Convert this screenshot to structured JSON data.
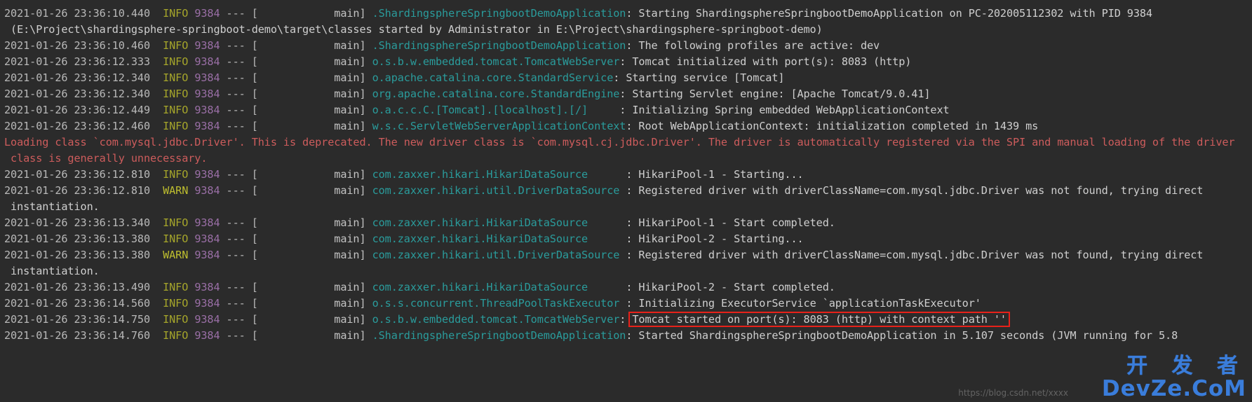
{
  "console": {
    "background_color": "#2b2b2b",
    "default_text_color": "#b7b7b7",
    "info_color": "#a5a52b",
    "warn_color": "#bdbd2f",
    "pid_color": "#9a6fa6",
    "logger_color": "#2a9c9c",
    "error_color": "#cd5c5c",
    "highlight_color": "#e8211a",
    "pid": "9384",
    "thread": "main"
  },
  "lines": [
    {
      "type": "log",
      "timestamp": "2021-01-26 23:36:10.440",
      "level": "INFO",
      "pid": "9384",
      "sep": "--- [",
      "thread": "            main]",
      "logger": ".ShardingsphereSpringbootDemoApplication",
      "colon": ": ",
      "message": "Starting ShardingsphereSpringbootDemoApplication on PC-202005112302 with PID 9384"
    },
    {
      "type": "continuation",
      "text": " (E:\\Project\\shardingsphere-springboot-demo\\target\\classes started by Administrator in E:\\Project\\shardingsphere-springboot-demo)"
    },
    {
      "type": "log",
      "timestamp": "2021-01-26 23:36:10.460",
      "level": "INFO",
      "pid": "9384",
      "sep": "--- [",
      "thread": "            main]",
      "logger": ".ShardingsphereSpringbootDemoApplication",
      "colon": ": ",
      "message": "The following profiles are active: dev"
    },
    {
      "type": "log",
      "timestamp": "2021-01-26 23:36:12.333",
      "level": "INFO",
      "pid": "9384",
      "sep": "--- [",
      "thread": "            main]",
      "logger": "o.s.b.w.embedded.tomcat.TomcatWebServer",
      "colon": ": ",
      "message": "Tomcat initialized with port(s): 8083 (http)"
    },
    {
      "type": "log",
      "timestamp": "2021-01-26 23:36:12.340",
      "level": "INFO",
      "pid": "9384",
      "sep": "--- [",
      "thread": "            main]",
      "logger": "o.apache.catalina.core.StandardService",
      "colon": ": ",
      "message": "Starting service [Tomcat]"
    },
    {
      "type": "log",
      "timestamp": "2021-01-26 23:36:12.340",
      "level": "INFO",
      "pid": "9384",
      "sep": "--- [",
      "thread": "            main]",
      "logger": "org.apache.catalina.core.StandardEngine",
      "colon": ": ",
      "message": "Starting Servlet engine: [Apache Tomcat/9.0.41]"
    },
    {
      "type": "log",
      "timestamp": "2021-01-26 23:36:12.449",
      "level": "INFO",
      "pid": "9384",
      "sep": "--- [",
      "thread": "            main]",
      "logger": "o.a.c.c.C.[Tomcat].[localhost].[/]",
      "colon": "     : ",
      "message": "Initializing Spring embedded WebApplicationContext"
    },
    {
      "type": "log",
      "timestamp": "2021-01-26 23:36:12.460",
      "level": "INFO",
      "pid": "9384",
      "sep": "--- [",
      "thread": "            main]",
      "logger": "w.s.c.ServletWebServerApplicationContext",
      "colon": ": ",
      "message": "Root WebApplicationContext: initialization completed in 1439 ms"
    },
    {
      "type": "error",
      "text": "Loading class `com.mysql.jdbc.Driver'. This is deprecated. The new driver class is `com.mysql.cj.jdbc.Driver'. The driver is automatically registered via the SPI and manual loading of the driver"
    },
    {
      "type": "error",
      "text": " class is generally unnecessary."
    },
    {
      "type": "log",
      "timestamp": "2021-01-26 23:36:12.810",
      "level": "INFO",
      "pid": "9384",
      "sep": "--- [",
      "thread": "            main]",
      "logger": "com.zaxxer.hikari.HikariDataSource",
      "colon": "      : ",
      "message": "HikariPool-1 - Starting..."
    },
    {
      "type": "log",
      "timestamp": "2021-01-26 23:36:12.810",
      "level": "WARN",
      "pid": "9384",
      "sep": "--- [",
      "thread": "            main]",
      "logger": "com.zaxxer.hikari.util.DriverDataSource",
      "colon": " : ",
      "message": "Registered driver with driverClassName=com.mysql.jdbc.Driver was not found, trying direct"
    },
    {
      "type": "continuation",
      "text": " instantiation."
    },
    {
      "type": "log",
      "timestamp": "2021-01-26 23:36:13.340",
      "level": "INFO",
      "pid": "9384",
      "sep": "--- [",
      "thread": "            main]",
      "logger": "com.zaxxer.hikari.HikariDataSource",
      "colon": "      : ",
      "message": "HikariPool-1 - Start completed."
    },
    {
      "type": "log",
      "timestamp": "2021-01-26 23:36:13.380",
      "level": "INFO",
      "pid": "9384",
      "sep": "--- [",
      "thread": "            main]",
      "logger": "com.zaxxer.hikari.HikariDataSource",
      "colon": "      : ",
      "message": "HikariPool-2 - Starting..."
    },
    {
      "type": "log",
      "timestamp": "2021-01-26 23:36:13.380",
      "level": "WARN",
      "pid": "9384",
      "sep": "--- [",
      "thread": "            main]",
      "logger": "com.zaxxer.hikari.util.DriverDataSource",
      "colon": " : ",
      "message": "Registered driver with driverClassName=com.mysql.jdbc.Driver was not found, trying direct"
    },
    {
      "type": "continuation",
      "text": " instantiation."
    },
    {
      "type": "log",
      "timestamp": "2021-01-26 23:36:13.490",
      "level": "INFO",
      "pid": "9384",
      "sep": "--- [",
      "thread": "            main]",
      "logger": "com.zaxxer.hikari.HikariDataSource",
      "colon": "      : ",
      "message": "HikariPool-2 - Start completed."
    },
    {
      "type": "log",
      "timestamp": "2021-01-26 23:36:14.560",
      "level": "INFO",
      "pid": "9384",
      "sep": "--- [",
      "thread": "            main]",
      "logger": "o.s.s.concurrent.ThreadPoolTaskExecutor",
      "colon": " : ",
      "message": "Initializing ExecutorService `applicationTaskExecutor'"
    },
    {
      "type": "log",
      "timestamp": "2021-01-26 23:36:14.750",
      "level": "INFO",
      "pid": "9384",
      "sep": "--- [",
      "thread": "            main]",
      "logger": "o.s.b.w.embedded.tomcat.TomcatWebServer",
      "colon": ": ",
      "message": "Tomcat started on port(s): 8083 (http) with context path ''",
      "highlighted": true
    },
    {
      "type": "log",
      "timestamp": "2021-01-26 23:36:14.760",
      "level": "INFO",
      "pid": "9384",
      "sep": "--- [",
      "thread": "            main]",
      "logger": ".ShardingsphereSpringbootDemoApplication",
      "colon": ": ",
      "message": "Started ShardingsphereSpringbootDemoApplication in 5.107 seconds (JVM running for 5.8"
    }
  ],
  "watermark": {
    "chinese": "开 发 者",
    "english": "DevZe.CoM",
    "url": "https://blog.csdn.net/xxxx",
    "color": "#3a7ddb"
  }
}
